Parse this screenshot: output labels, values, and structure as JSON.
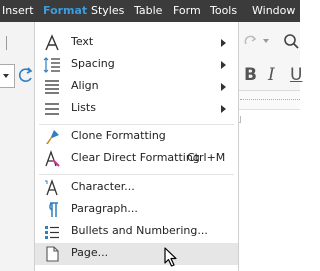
{
  "menubar": {
    "items": [
      "Insert",
      "Format",
      "Styles",
      "Table",
      "Form",
      "Tools",
      "Window"
    ],
    "active": "Format"
  },
  "toolbar": {
    "bold_label": "B",
    "italic_label": "I",
    "underline_label": "U"
  },
  "format_menu": {
    "items": [
      {
        "label": "Text",
        "icon": "text-icon",
        "submenu": true
      },
      {
        "label": "Spacing",
        "icon": "spacing-icon",
        "submenu": true
      },
      {
        "label": "Align",
        "icon": "align-icon",
        "submenu": true
      },
      {
        "label": "Lists",
        "icon": "lists-icon",
        "submenu": true
      },
      {
        "label": "Clone Formatting",
        "icon": "clone-formatting-icon"
      },
      {
        "label": "Clear Direct Formatting",
        "icon": "clear-formatting-icon",
        "shortcut": "Ctrl+M"
      },
      {
        "label": "Character...",
        "icon": "character-icon"
      },
      {
        "label": "Paragraph...",
        "icon": "paragraph-icon"
      },
      {
        "label": "Bullets and Numbering...",
        "icon": "bullets-numbering-icon"
      },
      {
        "label": "Page...",
        "icon": "page-icon",
        "highlighted": true
      }
    ]
  },
  "colors": {
    "menubar_bg": "#3b3b3b",
    "active_menu": "#3d9be0",
    "hover_row": "#e6e6e6",
    "icon_blue": "#2f7fc1"
  }
}
